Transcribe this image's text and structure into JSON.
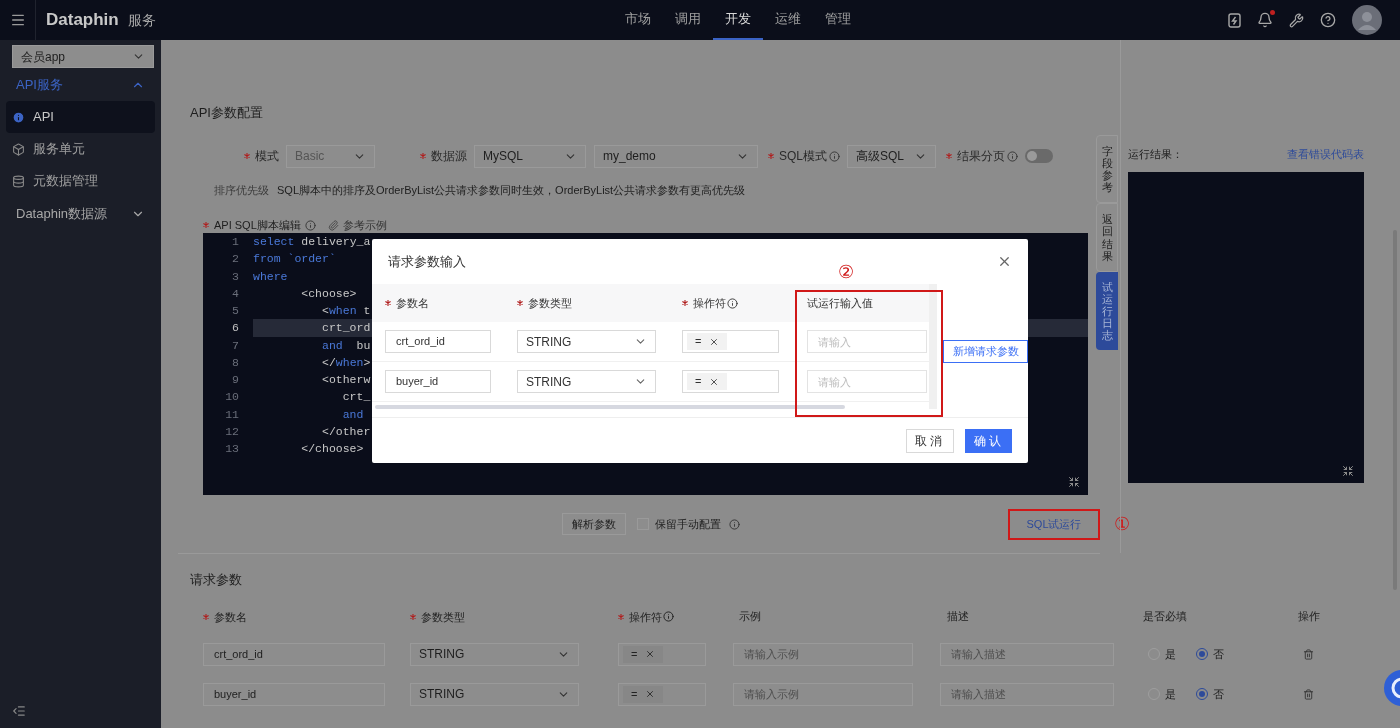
{
  "header": {
    "logo": "Dataphin",
    "product": "服务",
    "nav": [
      {
        "label": "市场",
        "selected": false
      },
      {
        "label": "调用",
        "selected": false
      },
      {
        "label": "开发",
        "selected": true
      },
      {
        "label": "运维",
        "selected": false
      },
      {
        "label": "管理",
        "selected": false
      }
    ],
    "notification": true
  },
  "sidebar": {
    "app_select": "会员app",
    "groups": [
      {
        "label": "API服务",
        "expanded": true,
        "children": [
          {
            "label": "API",
            "selected": true
          },
          {
            "label": "服务单元",
            "selected": false
          },
          {
            "label": "元数据管理",
            "selected": false
          }
        ]
      },
      {
        "label": "Dataphin数据源",
        "expanded": false
      }
    ]
  },
  "config": {
    "title": "API参数配置",
    "mode": {
      "label": "模式",
      "required": true,
      "value": "Basic",
      "disabled": true
    },
    "datasource": {
      "label": "数据源",
      "required": true,
      "type": "MySQL",
      "name": "my_demo"
    },
    "sql_mode": {
      "label": "SQL模式",
      "required": true,
      "value": "高级SQL"
    },
    "paging": {
      "label": "结果分页",
      "required": true,
      "on": false
    },
    "sort_note": {
      "label": "排序优先级",
      "text": "SQL脚本中的排序及OrderByList公共请求参数同时生效，OrderByList公共请求参数有更高优先级"
    },
    "script": {
      "label": "API SQL脚本编辑",
      "required": true,
      "example_link": "参考示例"
    },
    "code_lines": [
      {
        "number": "1",
        "active": false,
        "tokens": [
          {
            "text": "select",
            "kind": "keyword"
          },
          {
            "text": " delivery_a",
            "kind": "plain"
          }
        ]
      },
      {
        "number": "2",
        "active": false,
        "tokens": [
          {
            "text": "from `order`",
            "kind": "keyword"
          }
        ]
      },
      {
        "number": "3",
        "active": false,
        "tokens": [
          {
            "text": "where",
            "kind": "keyword"
          }
        ]
      },
      {
        "number": "4",
        "active": false,
        "tokens": [
          {
            "text": "       <choose>",
            "kind": "plain"
          }
        ]
      },
      {
        "number": "5",
        "active": false,
        "tokens": [
          {
            "text": "          <",
            "kind": "plain"
          },
          {
            "text": "when",
            "kind": "keyword"
          },
          {
            "text": " t",
            "kind": "plain"
          }
        ]
      },
      {
        "number": "6",
        "active": true,
        "tokens": [
          {
            "text": "          crt_ord",
            "kind": "plain"
          }
        ]
      },
      {
        "number": "7",
        "active": false,
        "tokens": [
          {
            "text": "          and",
            "kind": "keyword"
          },
          {
            "text": "  bu",
            "kind": "plain"
          }
        ]
      },
      {
        "number": "8",
        "active": false,
        "tokens": [
          {
            "text": "          </",
            "kind": "plain"
          },
          {
            "text": "when",
            "kind": "keyword"
          },
          {
            "text": ">",
            "kind": "plain"
          }
        ]
      },
      {
        "number": "9",
        "active": false,
        "tokens": [
          {
            "text": "          <otherw",
            "kind": "plain"
          }
        ]
      },
      {
        "number": "10",
        "active": false,
        "tokens": [
          {
            "text": "             crt_",
            "kind": "plain"
          }
        ]
      },
      {
        "number": "11",
        "active": false,
        "tokens": [
          {
            "text": "             and",
            "kind": "keyword"
          }
        ]
      },
      {
        "number": "12",
        "active": false,
        "tokens": [
          {
            "text": "          </other",
            "kind": "plain"
          }
        ]
      },
      {
        "number": "13",
        "active": false,
        "tokens": [
          {
            "text": "       </choose>",
            "kind": "plain"
          }
        ]
      }
    ]
  },
  "side_tabs": [
    {
      "label": "字段参考",
      "selected": false
    },
    {
      "label": "返回结果",
      "selected": false
    },
    {
      "label": "试运行日志",
      "selected": true
    }
  ],
  "run_result": {
    "label": "运行结果：",
    "link": "查看错误代码表"
  },
  "actions": {
    "parse_button": "解析参数",
    "keep_manual": {
      "label": "保留手动配置",
      "checked": false
    },
    "trial_run_button": "SQL试运行",
    "annotation": "①"
  },
  "request_params": {
    "title": "请求参数",
    "columns": [
      {
        "label": "参数名",
        "required": true,
        "info": false
      },
      {
        "label": "参数类型",
        "required": true,
        "info": false
      },
      {
        "label": "操作符",
        "required": true,
        "info": true
      },
      {
        "label": "示例",
        "required": false,
        "info": false
      },
      {
        "label": "描述",
        "required": false,
        "info": false
      },
      {
        "label": "是否必填",
        "required": false,
        "info": false
      },
      {
        "label": "操作",
        "required": false,
        "info": false
      }
    ],
    "rows": [
      {
        "name": "crt_ord_id",
        "type": "STRING",
        "operator": "=",
        "example_placeholder": "请输入示例",
        "desc_placeholder": "请输入描述",
        "required_options": [
          {
            "label": "是",
            "selected": false
          },
          {
            "label": "否",
            "selected": true
          }
        ]
      },
      {
        "name": "buyer_id",
        "type": "STRING",
        "operator": "=",
        "example_placeholder": "请输入示例",
        "desc_placeholder": "请输入描述",
        "required_options": [
          {
            "label": "是",
            "selected": false
          },
          {
            "label": "否",
            "selected": true
          }
        ]
      }
    ]
  },
  "modal": {
    "title": "请求参数输入",
    "annotation": "②",
    "columns": [
      {
        "label": "参数名",
        "required": true,
        "info": false
      },
      {
        "label": "参数类型",
        "required": true,
        "info": false
      },
      {
        "label": "操作符",
        "required": true,
        "info": true
      },
      {
        "label": "试运行输入值",
        "required": false,
        "info": false
      }
    ],
    "rows": [
      {
        "name": "crt_ord_id",
        "type": "STRING",
        "operator": "=",
        "value_placeholder": "请输入"
      },
      {
        "name": "buyer_id",
        "type": "STRING",
        "operator": "=",
        "value_placeholder": "请输入"
      }
    ],
    "add_button": "新增请求参数",
    "cancel": "取消",
    "confirm": "确认"
  }
}
